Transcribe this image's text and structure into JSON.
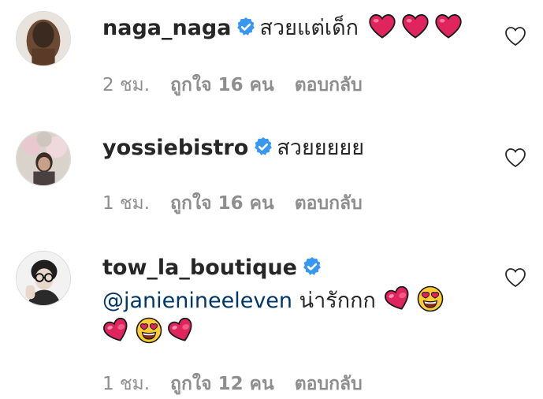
{
  "comments": [
    {
      "username": "naga_naga",
      "verified": true,
      "text": "สวยแต่เด็ก",
      "emoji": [
        "red-heart",
        "red-heart",
        "red-heart"
      ],
      "time": "2 ชม.",
      "likes": "ถูกใจ 16 คน",
      "reply": "ตอบกลับ"
    },
    {
      "username": "yossiebistro",
      "verified": true,
      "text": "สวยยยยย",
      "emoji": [],
      "time": "1 ชม.",
      "likes": "ถูกใจ 16 คน",
      "reply": "ตอบกลับ"
    },
    {
      "username": "tow_la_boutique",
      "verified": true,
      "mention": "@janienineeleven",
      "text": "น่ารักกก",
      "emoji": [
        "sparkling-heart",
        "heart-eyes-face",
        "sparkling-heart",
        "heart-eyes-face",
        "sparkling-heart"
      ],
      "time": "1 ชม.",
      "likes": "ถูกใจ 12 คน",
      "reply": "ตอบกลับ"
    }
  ],
  "colors": {
    "verified_blue": "#3897f0",
    "heart_red": "#e0245e",
    "mention_blue": "#00376b",
    "meta_gray": "#8e8e8e"
  }
}
